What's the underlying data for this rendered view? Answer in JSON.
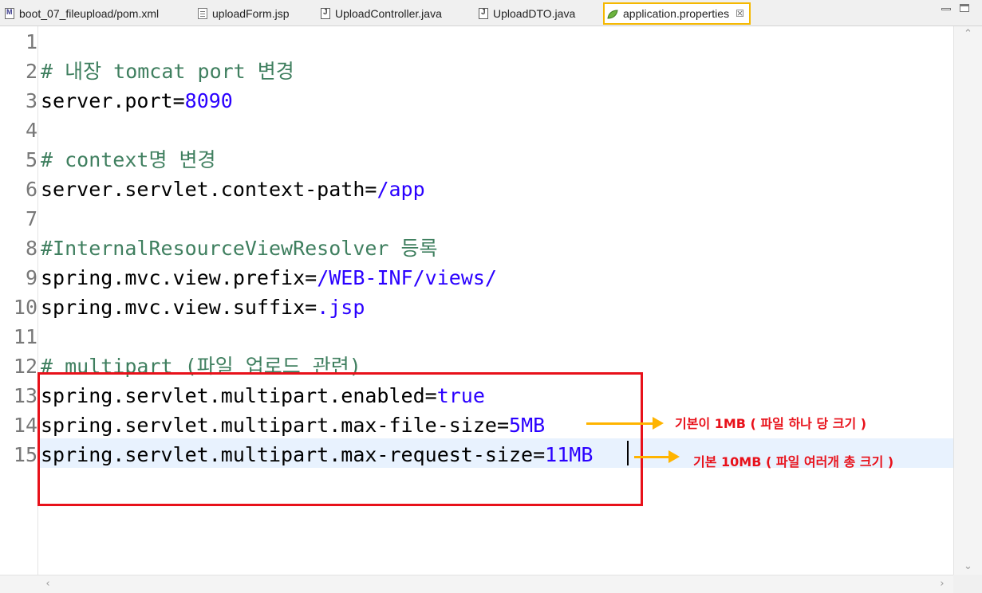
{
  "tabs": [
    {
      "label": "boot_07_fileupload/pom.xml",
      "icon": "xml-file-icon"
    },
    {
      "label": "uploadForm.jsp",
      "icon": "jsp-file-icon"
    },
    {
      "label": "UploadController.java",
      "icon": "java-file-icon"
    },
    {
      "label": "UploadDTO.java",
      "icon": "java-file-icon"
    },
    {
      "label": "application.properties",
      "icon": "spring-leaf-icon",
      "active": true,
      "close": "☒"
    }
  ],
  "editor": {
    "lines": [
      {
        "n": "1",
        "comment": "",
        "key": "",
        "eq": "",
        "value": ""
      },
      {
        "n": "2",
        "comment": "# 내장 tomcat port 변경",
        "key": "",
        "eq": "",
        "value": ""
      },
      {
        "n": "3",
        "comment": "",
        "key": "server.port",
        "eq": "=",
        "value": "8090"
      },
      {
        "n": "4",
        "comment": "",
        "key": "",
        "eq": "",
        "value": ""
      },
      {
        "n": "5",
        "comment": "# context명 변경",
        "key": "",
        "eq": "",
        "value": ""
      },
      {
        "n": "6",
        "comment": "",
        "key": "server.servlet.context-path",
        "eq": "=",
        "value": "/app"
      },
      {
        "n": "7",
        "comment": "",
        "key": "",
        "eq": "",
        "value": ""
      },
      {
        "n": "8",
        "comment": "#InternalResourceViewResolver 등록",
        "key": "",
        "eq": "",
        "value": ""
      },
      {
        "n": "9",
        "comment": "",
        "key": "spring.mvc.view.prefix",
        "eq": "=",
        "value": "/WEB-INF/views/"
      },
      {
        "n": "10",
        "comment": "",
        "key": "spring.mvc.view.suffix",
        "eq": "=",
        "value": ".jsp"
      },
      {
        "n": "11",
        "comment": "",
        "key": "",
        "eq": "",
        "value": ""
      },
      {
        "n": "12",
        "comment": "# multipart (파일 업로드 관련)",
        "key": "",
        "eq": "",
        "value": ""
      },
      {
        "n": "13",
        "comment": "",
        "key": "spring.servlet.multipart.enabled",
        "eq": "=",
        "value": "true"
      },
      {
        "n": "14",
        "comment": "",
        "key": "spring.servlet.multipart.max-file-size",
        "eq": "=",
        "value": "5MB"
      },
      {
        "n": "15",
        "comment": "",
        "key": "spring.servlet.multipart.max-request-size",
        "eq": "=",
        "value": "11MB"
      }
    ]
  },
  "annotations": {
    "note1": "기본이 1MB ( 파일 하나 당 크기 )",
    "note2": "기본 10MB ( 파일 여러개 총 크기 )",
    "box_color": "#e8111a",
    "arrow_color": "#ffb400"
  },
  "colors": {
    "comment": "#3f7f5f",
    "value": "#2a00ff",
    "active_tab_border": "#f5b800",
    "current_line": "#e8f2fe"
  }
}
